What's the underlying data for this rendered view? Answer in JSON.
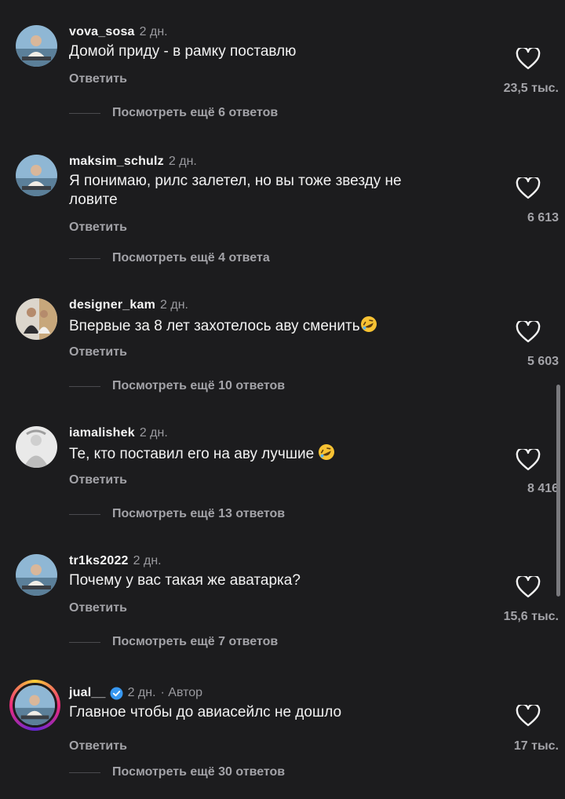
{
  "comments": [
    {
      "username": "vova_sosa",
      "time": "2 дн.",
      "text": "Домой приду - в рамку поставлю",
      "reply_label": "Ответить",
      "likes": "23,5 тыс.",
      "view_more": "Посмотреть ещё 6 ответов"
    },
    {
      "username": "maksim_schulz",
      "time": "2 дн.",
      "text": "Я понимаю, рилс залетел, но вы тоже звезду не ловите",
      "reply_label": "Ответить",
      "likes": "6 613",
      "view_more": "Посмотреть ещё 4 ответа"
    },
    {
      "username": "designer_kam",
      "time": "2 дн.",
      "text": "Впервые за 8 лет захотелось аву сменить",
      "emoji": "rofl-emoji",
      "reply_label": "Ответить",
      "likes": "5 603",
      "view_more": "Посмотреть ещё 10 ответов"
    },
    {
      "username": "iamalishek",
      "time": "2 дн.",
      "text": "Те, кто поставил его на аву лучшие ",
      "emoji": "rofl-emoji",
      "reply_label": "Ответить",
      "likes": "8 416",
      "view_more": "Посмотреть ещё 13 ответов"
    },
    {
      "username": "tr1ks2022",
      "time": "2 дн.",
      "text": "Почему у вас такая же аватарка?",
      "reply_label": "Ответить",
      "likes": "15,6 тыс.",
      "view_more": "Посмотреть ещё 7 ответов"
    },
    {
      "username": "jual__",
      "time": "2 дн.",
      "author_label": "· Автор",
      "verified": true,
      "text": "Главное чтобы до авиасейлс не дошло",
      "reply_label": "Ответить",
      "likes": "17 тыс.",
      "view_more": "Посмотреть ещё 30 ответов"
    }
  ],
  "icons": {
    "like": "heart-outline-icon",
    "verified": "verified-badge-icon"
  },
  "colors": {
    "background": "#1c1c1e",
    "text": "#f2f2f2",
    "muted": "#a3a3a8",
    "verified": "#3797f0"
  }
}
